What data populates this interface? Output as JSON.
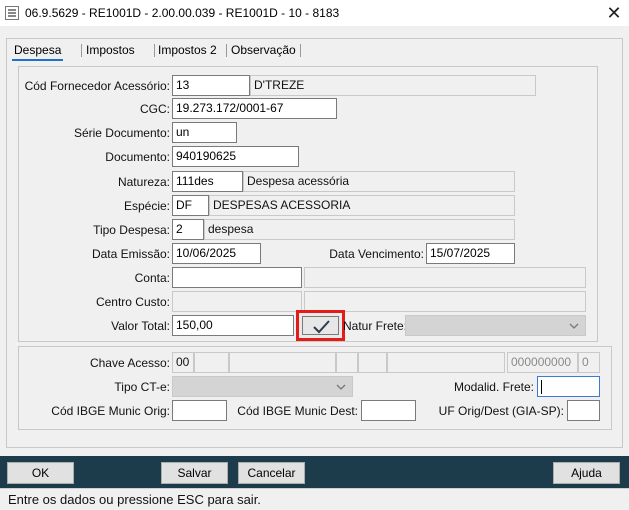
{
  "window": {
    "title": "06.9.5629 - RE1001D - 2.00.00.039 - RE1001D - 10 - 8183",
    "close_glyph": "✕"
  },
  "tabs": [
    {
      "label": "Despesa"
    },
    {
      "label": "Impostos"
    },
    {
      "label": "Impostos 2"
    },
    {
      "label": "Observação"
    }
  ],
  "form": {
    "cod_fornecedor": {
      "label": "Cód Fornecedor Acessório:",
      "value": "13",
      "desc": "D'TREZE"
    },
    "cgc": {
      "label": "CGC:",
      "value": "19.273.172/0001-67"
    },
    "serie": {
      "label": "Série Documento:",
      "value": "un"
    },
    "documento": {
      "label": "Documento:",
      "value": "940190625"
    },
    "natureza": {
      "label": "Natureza:",
      "value": "111des",
      "desc": "Despesa acessória"
    },
    "especie": {
      "label": "Espécie:",
      "value": "DF",
      "desc": "DESPESAS ACESSORIA"
    },
    "tipo_despesa": {
      "label": "Tipo Despesa:",
      "value": "2",
      "desc": "despesa"
    },
    "data_emissao": {
      "label": "Data Emissão:",
      "value": "10/06/2025"
    },
    "data_vencimento": {
      "label": "Data Vencimento:",
      "value": "15/07/2025"
    },
    "conta": {
      "label": "Conta:",
      "value": ""
    },
    "centro_custo": {
      "label": "Centro Custo:",
      "value": ""
    },
    "valor_total": {
      "label": "Valor Total:",
      "value": "150,00"
    },
    "natur_frete": {
      "label": "Natur Frete:",
      "value": ""
    }
  },
  "frete": {
    "chave_acesso": {
      "label": "Chave Acesso:",
      "part1": "00",
      "part_num": "000000000",
      "part_dv": "0"
    },
    "tipo_cte": {
      "label": "Tipo CT-e:",
      "value": ""
    },
    "modalid_frete": {
      "label": "Modalid. Frete:",
      "value": ""
    },
    "ibge_orig": {
      "label": "Cód IBGE Munic Orig:",
      "value": ""
    },
    "ibge_dest": {
      "label": "Cód IBGE Munic Dest:",
      "value": ""
    },
    "uf_orig_dest": {
      "label": "UF Orig/Dest (GIA-SP):",
      "value": ""
    }
  },
  "buttons": {
    "ok": "OK",
    "salvar": "Salvar",
    "cancelar": "Cancelar",
    "ajuda": "Ajuda"
  },
  "status": "Entre os dados ou pressione ESC para sair.",
  "colors": {
    "bottom_bar": "#1c3c4c",
    "tab_active": "#1e73c8",
    "highlight": "#e41b1b"
  },
  "icons": {
    "confirm": "check-icon",
    "dropdown": "chevron-down-icon"
  }
}
